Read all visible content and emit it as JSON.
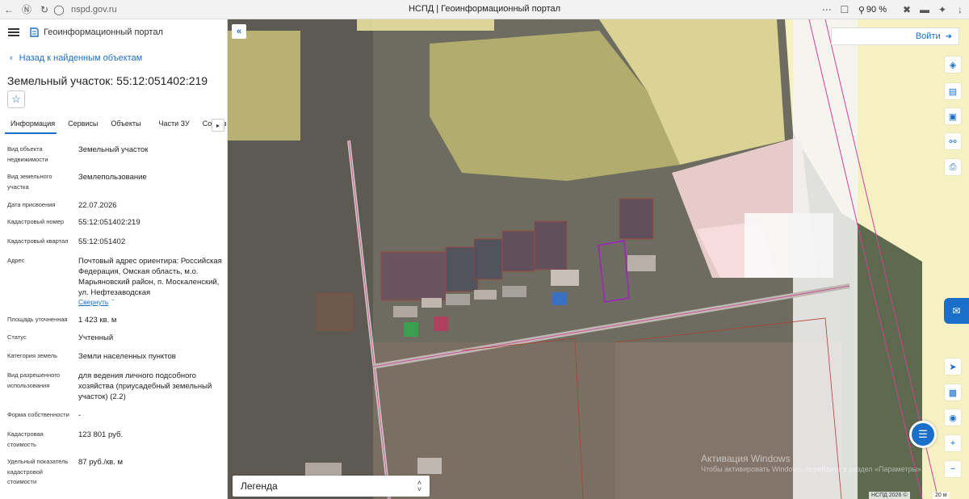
{
  "browser": {
    "url": "nspd.gov.ru",
    "tab_title": "НСПД | Геоинформационный портал",
    "zoom": "90 %"
  },
  "sidebar": {
    "portal_name": "Геоинформационный портал",
    "back_link": "Назад к найденным объектам",
    "title": "Земельный участок: 55:12:051402:219",
    "tabs": [
      "Информация",
      "Сервисы",
      "Объекты",
      "Части ЗУ",
      "Состав"
    ],
    "attributes": [
      {
        "label": "Вид объекта недвижимости",
        "value": "Земельный участок"
      },
      {
        "label": "Вид земельного участка",
        "value": "Землепользование"
      },
      {
        "label": "Дата присвоения",
        "value": "22.07.2026"
      },
      {
        "label": "Кадастровый номер",
        "value": "55:12:051402:219"
      },
      {
        "label": "Кадастровый квартал",
        "value": "55:12:051402"
      },
      {
        "label": "Адрес",
        "value": "Почтовый адрес ориентира: Российская Федерация, Омская область, м.о. Марьяновский район, п. Москаленский, ул. Нефтезаводская"
      },
      {
        "label": "Площадь уточненная",
        "value": "1 423 кв. м"
      },
      {
        "label": "Статус",
        "value": "Учтенный"
      },
      {
        "label": "Категория земель",
        "value": "Земли населенных пунктов"
      },
      {
        "label": "Вид разрешенного использования",
        "value": "для ведения личного подсобного хозяйства (приусадебный земельный участок) (2.2)"
      },
      {
        "label": "Форма собственности",
        "value": "-"
      },
      {
        "label": "Кадастровая стоимость",
        "value": "123 801 руб."
      },
      {
        "label": "Удельный показатель кадастровой стоимости",
        "value": "87 руб./кв. м"
      }
    ],
    "collapse_link": "Свернуть"
  },
  "map": {
    "login": "Войти",
    "legend": "Легенда",
    "watermark_title": "Активация Windows",
    "watermark_sub": "Чтобы активировать Windows, перейдите в раздел «Параметры».",
    "copyright": "НСПД 2026 ©",
    "scale": "20 м"
  },
  "colors": {
    "accent": "#1a6fc9",
    "zone_yellow": "#f5f0a0",
    "zone_pink": "#f8d8d8",
    "selected_parcel": "#a020c0"
  }
}
